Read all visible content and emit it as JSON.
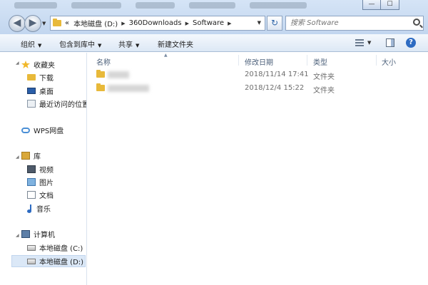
{
  "window": {
    "caption": {
      "minimize": "—",
      "maximize": "☐"
    }
  },
  "nav": {
    "back_glyph": "◀",
    "forward_glyph": "▶"
  },
  "address": {
    "overflow": "«",
    "crumbs": [
      "本地磁盘 (D:)",
      "360Downloads",
      "Software"
    ],
    "separator": "▶",
    "dropdown": "▼",
    "refresh_glyph": "↻"
  },
  "search": {
    "placeholder": "搜索 Software"
  },
  "toolbar": {
    "organize": "组织",
    "include_in_library": "包含到库中",
    "share": "共享",
    "new_folder": "新建文件夹",
    "dropdown_glyph": "▼",
    "help_glyph": "?"
  },
  "sidebar": {
    "favorites": {
      "label": "收藏夹",
      "items": [
        {
          "label": "下载",
          "icon": "downloads-folder-icon"
        },
        {
          "label": "桌面",
          "icon": "desktop-icon"
        },
        {
          "label": "最近访问的位置",
          "icon": "recent-places-icon"
        }
      ]
    },
    "wps": {
      "label": "WPS网盘",
      "icon": "cloud-icon"
    },
    "libraries": {
      "label": "库",
      "items": [
        {
          "label": "视频",
          "icon": "video-library-icon"
        },
        {
          "label": "图片",
          "icon": "pictures-library-icon"
        },
        {
          "label": "文档",
          "icon": "documents-library-icon"
        },
        {
          "label": "音乐",
          "icon": "music-library-icon"
        }
      ]
    },
    "computer": {
      "label": "计算机",
      "items": [
        {
          "label": "本地磁盘 (C:)",
          "icon": "drive-icon"
        },
        {
          "label": "本地磁盘 (D:)",
          "icon": "drive-icon",
          "selected": true
        }
      ]
    }
  },
  "file_list": {
    "columns": [
      "名称",
      "修改日期",
      "类型",
      "大小"
    ],
    "rows": [
      {
        "modified": "2018/11/14 17:41",
        "type": "文件夹"
      },
      {
        "modified": "2018/12/4 15:22",
        "type": "文件夹"
      }
    ]
  }
}
